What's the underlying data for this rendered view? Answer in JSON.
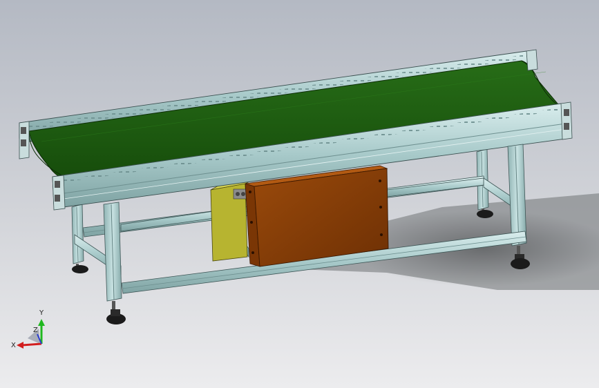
{
  "triad": {
    "x_label": "X",
    "y_label": "Y",
    "z_label": "Z",
    "colors": {
      "x": "#d21e1e",
      "y": "#1fb81f",
      "z": "#2a3cd0"
    }
  },
  "model": {
    "belt_color": "#1e5e10",
    "frame_color": "#a9cccc",
    "motor_cover_color": "#8a3e06",
    "motor_bracket_color": "#b7b430"
  }
}
